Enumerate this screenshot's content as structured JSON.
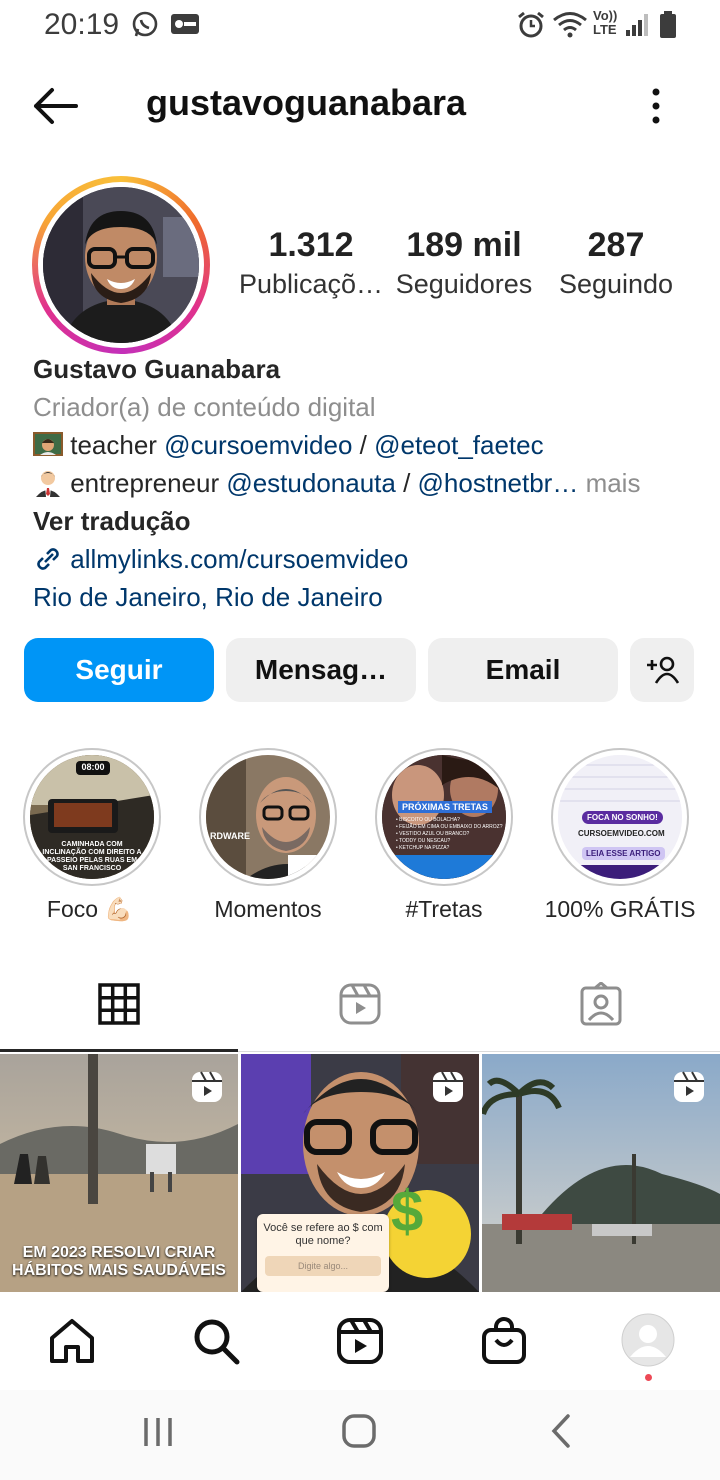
{
  "status_bar": {
    "time": "20:19",
    "network": "LTE",
    "volte": "Vo))"
  },
  "header": {
    "username": "gustavoguanabara"
  },
  "stats": [
    {
      "value": "1.312",
      "label": "Publicaçõ…"
    },
    {
      "value": "189 mil",
      "label": "Seguidores"
    },
    {
      "value": "287",
      "label": "Seguindo"
    }
  ],
  "bio": {
    "name": "Gustavo Guanabara",
    "category": "Criador(a) de conteúdo digital",
    "line1_text": " teacher ",
    "line1_link1": "@cursoemvideo",
    "line1_sep": " / ",
    "line1_link2": "@eteot_faetec",
    "line2_text": " entrepreneur ",
    "line2_link1": "@estudonauta",
    "line2_sep": " / ",
    "line2_link2": "@hostnetbr…",
    "line2_more": " mais",
    "translate": "Ver tradução",
    "website": "allmylinks.com/cursoemvideo",
    "location": "Rio de Janeiro, Rio de Janeiro"
  },
  "actions": {
    "follow": "Seguir",
    "message": "Mensag…",
    "email": "Email"
  },
  "highlights": [
    {
      "label": "Foco 💪🏻",
      "overlay_time": "08:00",
      "overlay_text": "CAMINHADA COM INCLINAÇÃO COM DIREITO A PASSEIO PELAS RUAS EM SAN FRANCISCO"
    },
    {
      "label": "Momentos",
      "overlay_text": "RDWARE"
    },
    {
      "label": "#Tretas",
      "overlay_text": "PRÓXIMAS TRETAS",
      "items": [
        "• BISCOITO OU BOLACHA?",
        "• FEIJÃO EM CIMA OU EMBAIXO DO ARROZ?",
        "• VESTIDO AZUL OU BRANCO?",
        "• TODDY OU NESCAU?",
        "• KETCHUP NA PIZZA?"
      ]
    },
    {
      "label": "100% GRÁTIS",
      "badge": "FOCA NO SONHO!",
      "site": "CURSOEMVIDEO.COM",
      "cta": "LEIA ESSE ARTIGO"
    }
  ],
  "posts": [
    {
      "caption": "EM 2023 RESOLVI CRIAR HÁBITOS MAIS SAUDÁVEIS"
    },
    {
      "question": "Você se refere ao $ com que nome?",
      "input_placeholder": "Digite algo..."
    },
    {
      "caption": ""
    }
  ],
  "colors": {
    "accent": "#0095f6",
    "link": "#00376b",
    "muted": "#8e8e8e",
    "notification_dot": "#ed4956"
  }
}
